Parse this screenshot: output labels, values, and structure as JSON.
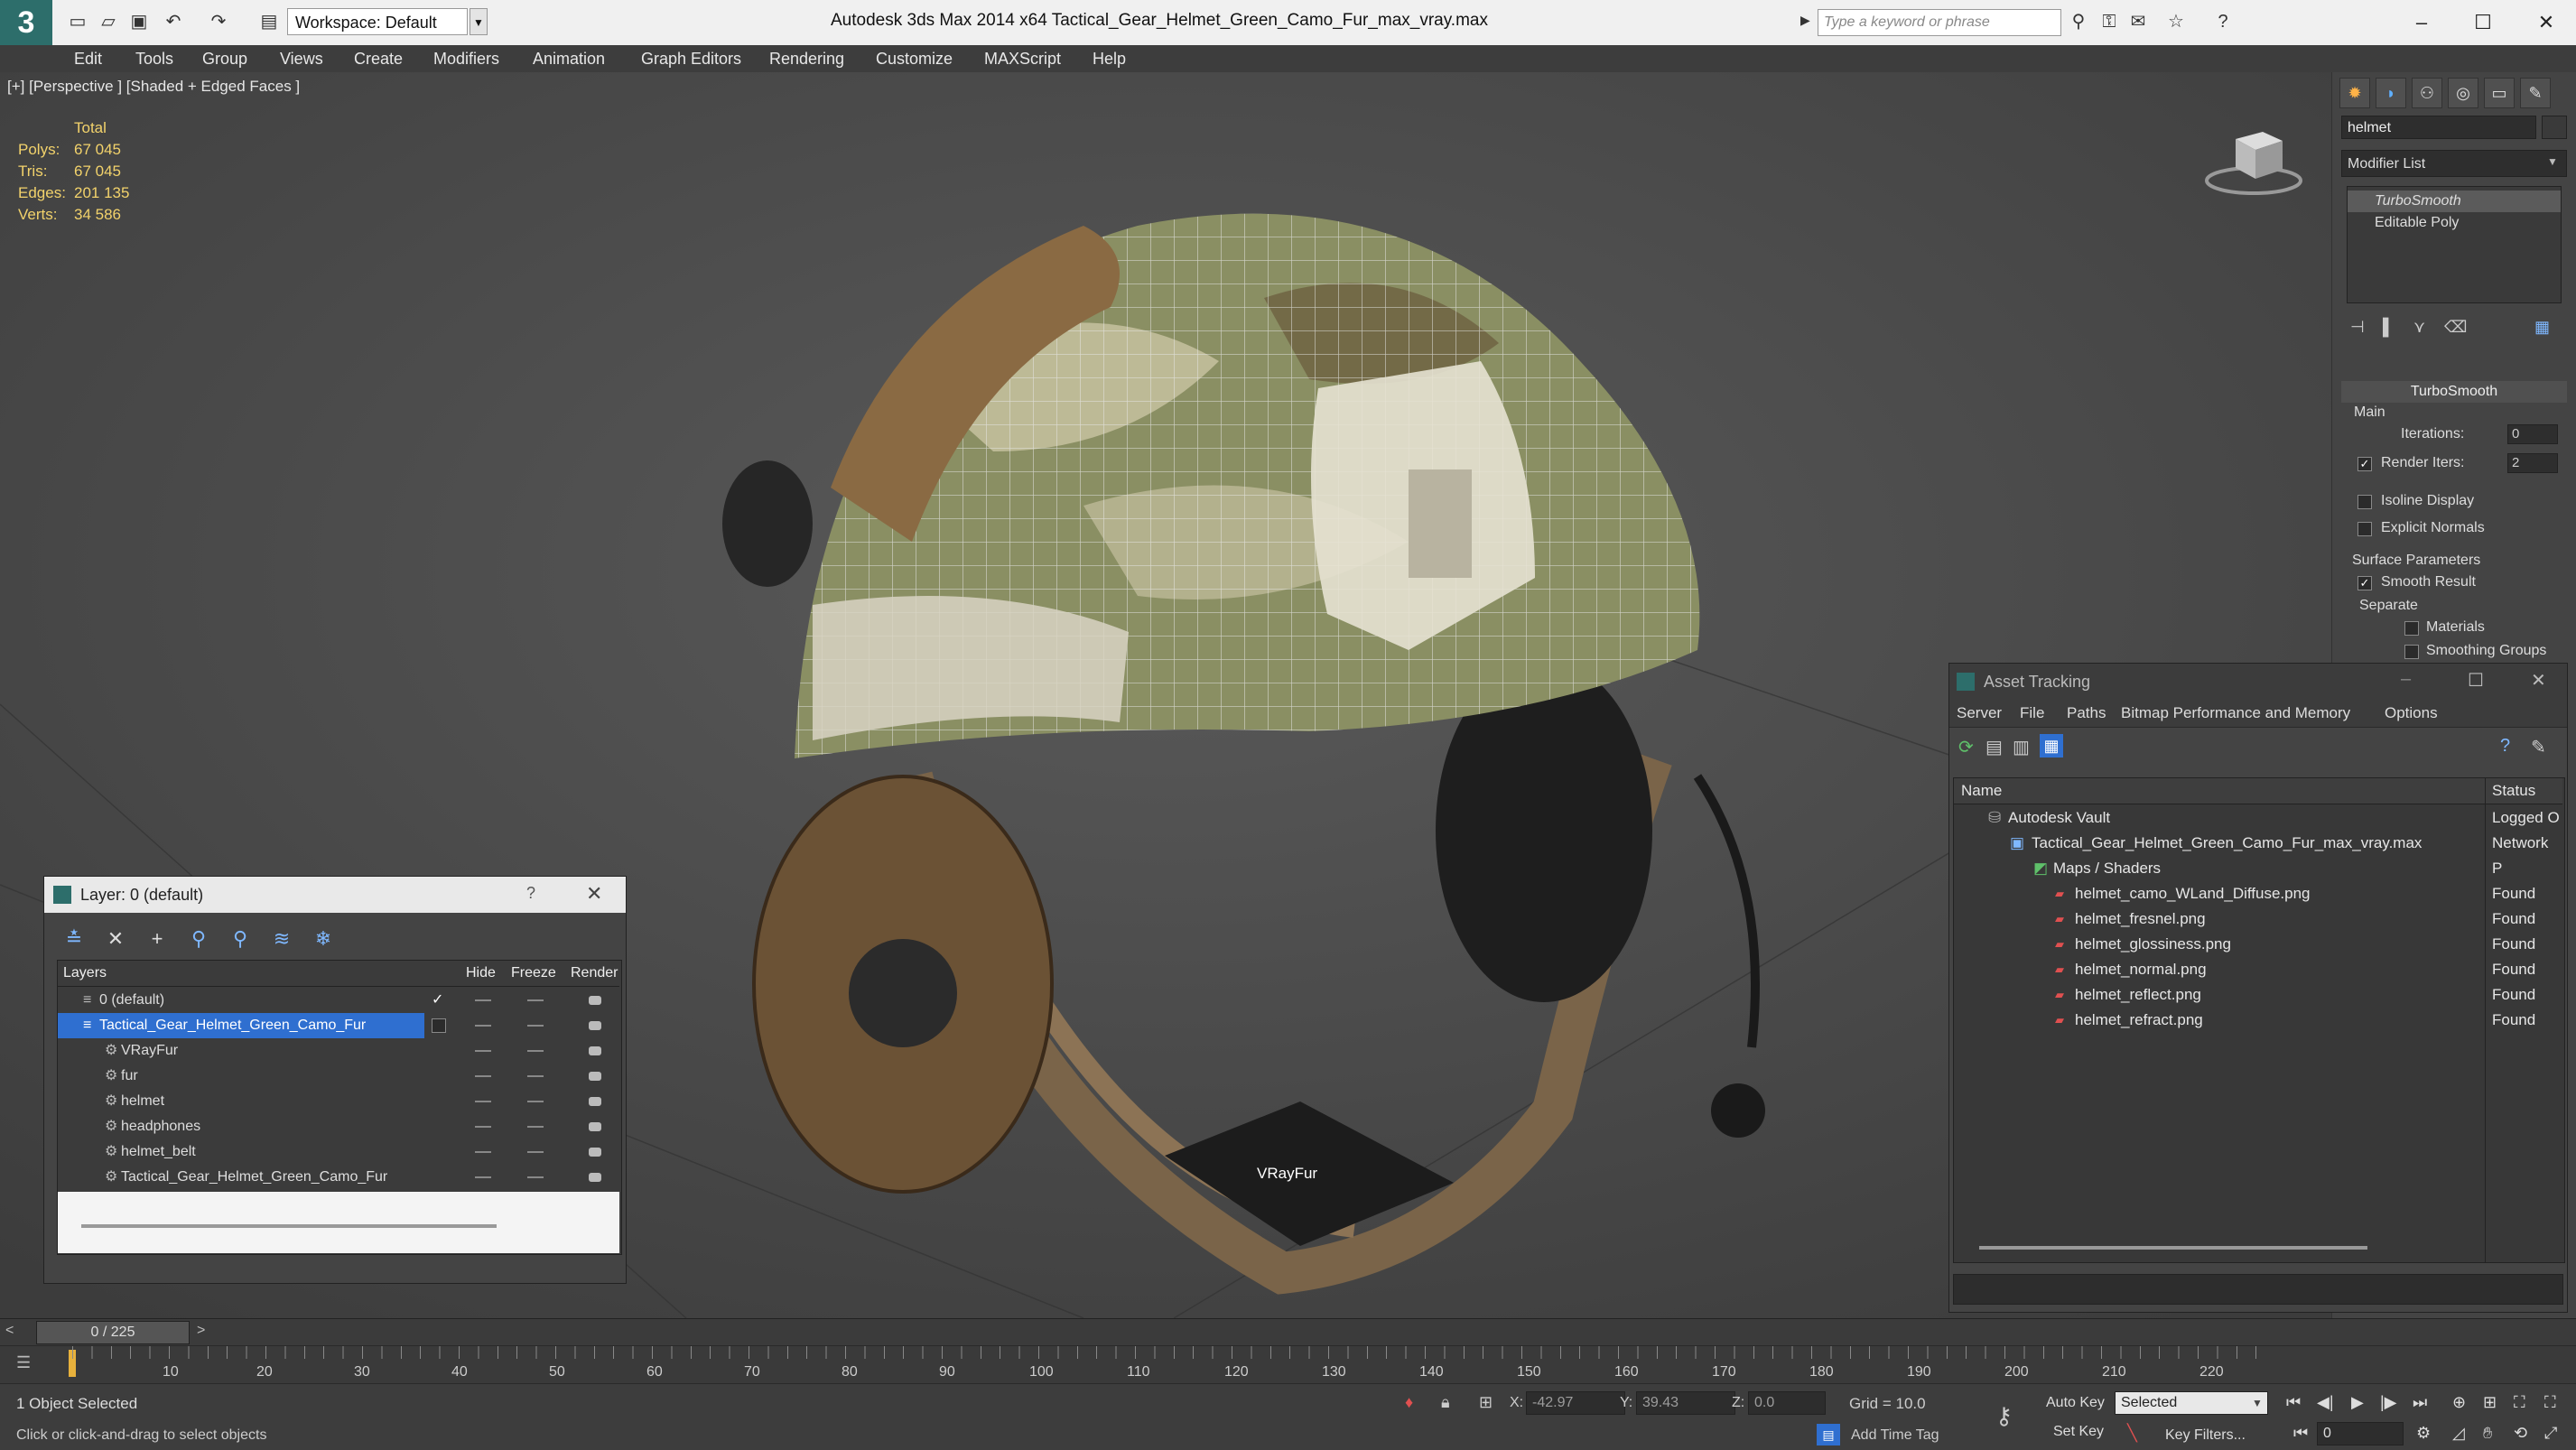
{
  "app": {
    "title": "Autodesk 3ds Max  2014 x64      Tactical_Gear_Helmet_Green_Camo_Fur_max_vray.max",
    "workspace": "Workspace: Default",
    "search_placeholder": "Type a keyword or phrase"
  },
  "menu": [
    "Edit",
    "Tools",
    "Group",
    "Views",
    "Create",
    "Modifiers",
    "Animation",
    "Graph Editors",
    "Rendering",
    "Customize",
    "MAXScript",
    "Help"
  ],
  "viewport": {
    "label": "[+] [Perspective ] [Shaded + Edged Faces ]",
    "stats": {
      "header": "Total",
      "rows": [
        {
          "k": "Polys:",
          "v": "67 045"
        },
        {
          "k": "Tris:",
          "v": "67 045"
        },
        {
          "k": "Edges:",
          "v": "201 135"
        },
        {
          "k": "Verts:",
          "v": "34 586"
        }
      ]
    },
    "vrayfur_label": "VRayFur"
  },
  "command_panel": {
    "object_name": "helmet",
    "modifier_list": "Modifier List",
    "stack": [
      "TurboSmooth",
      "Editable Poly"
    ],
    "rollout_title": "TurboSmooth",
    "main_label": "Main",
    "iterations_label": "Iterations:",
    "iterations_value": "0",
    "render_iters_label": "Render Iters:",
    "render_iters_value": "2",
    "isoline": "Isoline Display",
    "explicit_normals": "Explicit Normals",
    "surface_params": "Surface Parameters",
    "smooth_result": "Smooth Result",
    "separate": "Separate",
    "materials": "Materials",
    "smoothing_groups": "Smoothing Groups"
  },
  "layer_dialog": {
    "title": "Layer: 0 (default)",
    "help": "?",
    "columns": {
      "layers": "Layers",
      "hide": "Hide",
      "freeze": "Freeze",
      "render": "Render"
    },
    "rows": [
      {
        "name": "0 (default)",
        "indent": 0
      },
      {
        "name": "Tactical_Gear_Helmet_Green_Camo_Fur",
        "indent": 0
      },
      {
        "name": "VRayFur",
        "indent": 1
      },
      {
        "name": "fur",
        "indent": 1
      },
      {
        "name": "helmet",
        "indent": 1
      },
      {
        "name": "headphones",
        "indent": 1
      },
      {
        "name": "helmet_belt",
        "indent": 1
      },
      {
        "name": "Tactical_Gear_Helmet_Green_Camo_Fur",
        "indent": 1
      }
    ]
  },
  "asset_tracking": {
    "title": "Asset Tracking",
    "menu": [
      "Server",
      "File",
      "Paths",
      "Bitmap Performance and Memory",
      "Options"
    ],
    "columns": {
      "name": "Name",
      "status": "Status"
    },
    "rows": [
      {
        "name": "Autodesk Vault",
        "status": "Logged O",
        "indent": 0
      },
      {
        "name": "Tactical_Gear_Helmet_Green_Camo_Fur_max_vray.max",
        "status": "Network P",
        "indent": 1
      },
      {
        "name": "Maps / Shaders",
        "status": "",
        "indent": 2
      },
      {
        "name": "helmet_camo_WLand_Diffuse.png",
        "status": "Found",
        "indent": 3
      },
      {
        "name": "helmet_fresnel.png",
        "status": "Found",
        "indent": 3
      },
      {
        "name": "helmet_glossiness.png",
        "status": "Found",
        "indent": 3
      },
      {
        "name": "helmet_normal.png",
        "status": "Found",
        "indent": 3
      },
      {
        "name": "helmet_reflect.png",
        "status": "Found",
        "indent": 3
      },
      {
        "name": "helmet_refract.png",
        "status": "Found",
        "indent": 3
      }
    ]
  },
  "timeline": {
    "frame": "0 / 225",
    "ticks": [
      "10",
      "20",
      "30",
      "40",
      "50",
      "60",
      "70",
      "80",
      "90",
      "100",
      "110",
      "120",
      "130",
      "140",
      "150",
      "160",
      "170",
      "180",
      "190",
      "200",
      "210",
      "220"
    ]
  },
  "status": {
    "selected": "1 Object Selected",
    "prompt": "Click or click-and-drag to select objects",
    "x_label": "X:",
    "x_value": "-42.97",
    "y_label": "Y:",
    "y_value": "39.43",
    "z_label": "Z:",
    "z_value": "0.0",
    "grid": "Grid = 10.0",
    "add_time_tag": "Add Time Tag",
    "auto_key": "Auto Key",
    "selected_combo": "Selected",
    "set_key": "Set Key",
    "key_filters": "Key Filters...",
    "frame_field": "0"
  }
}
